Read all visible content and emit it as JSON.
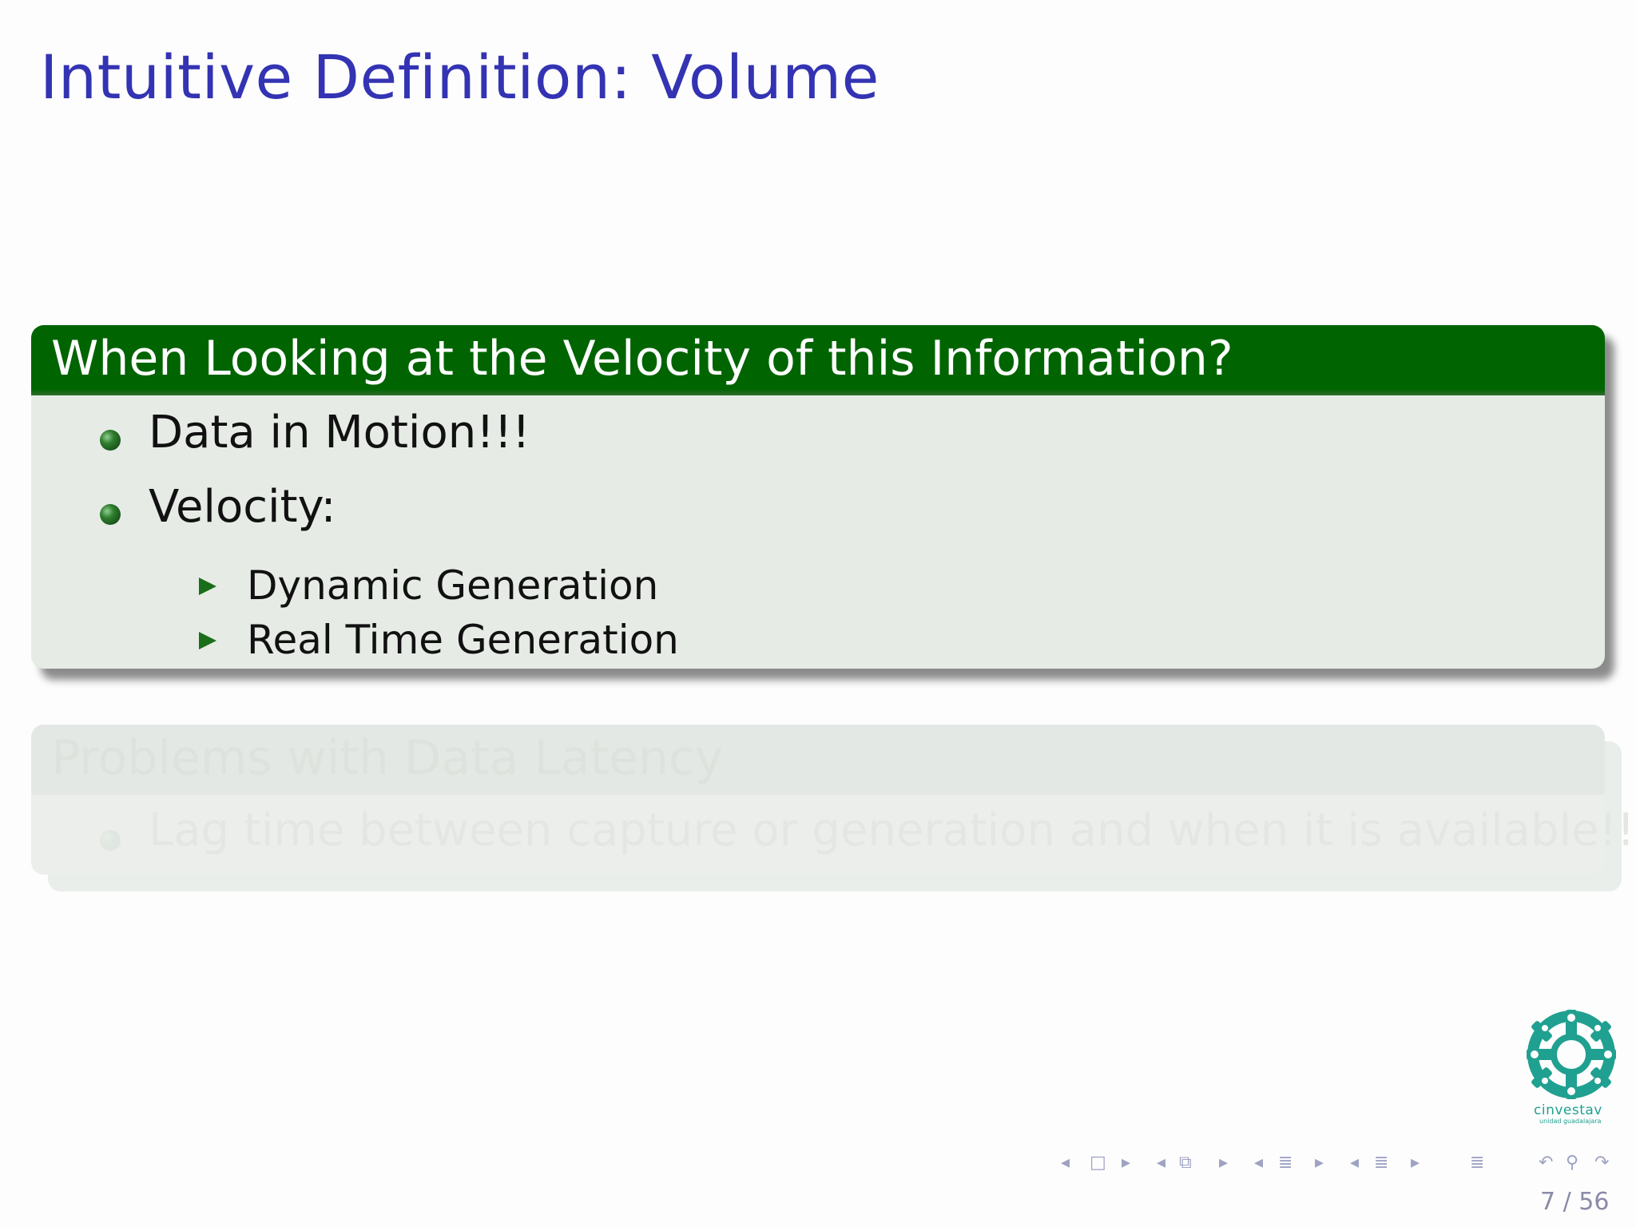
{
  "slide": {
    "title": "Intuitive Definition: Volume",
    "block1": {
      "header": "When Looking at the Velocity of this Information?",
      "items": [
        "Data in Motion!!!",
        "Velocity:"
      ],
      "subitems": [
        "Dynamic Generation",
        "Real Time Generation"
      ]
    },
    "block2": {
      "header": "Problems with Data Latency",
      "items": [
        "Lag time between capture or generation and when it is available!!!"
      ]
    },
    "logo": {
      "name": "cinvestav",
      "sub": "unidad guadalajara"
    },
    "page": "7 / 56"
  },
  "colors": {
    "title": "#3333b3",
    "block_header": "#006400",
    "block_body": "#e6ebe6",
    "bullet": "#2f7d2f",
    "logo": "#20a090"
  },
  "icons": [
    "bullet-ball-icon",
    "bullet-triangle-icon",
    "nav-arrow-left-icon",
    "nav-frame-icon",
    "nav-arrow-right-icon",
    "nav-subsection-icon",
    "nav-section-icon",
    "nav-align-icon",
    "nav-back-icon",
    "nav-search-icon",
    "nav-forward-icon"
  ]
}
